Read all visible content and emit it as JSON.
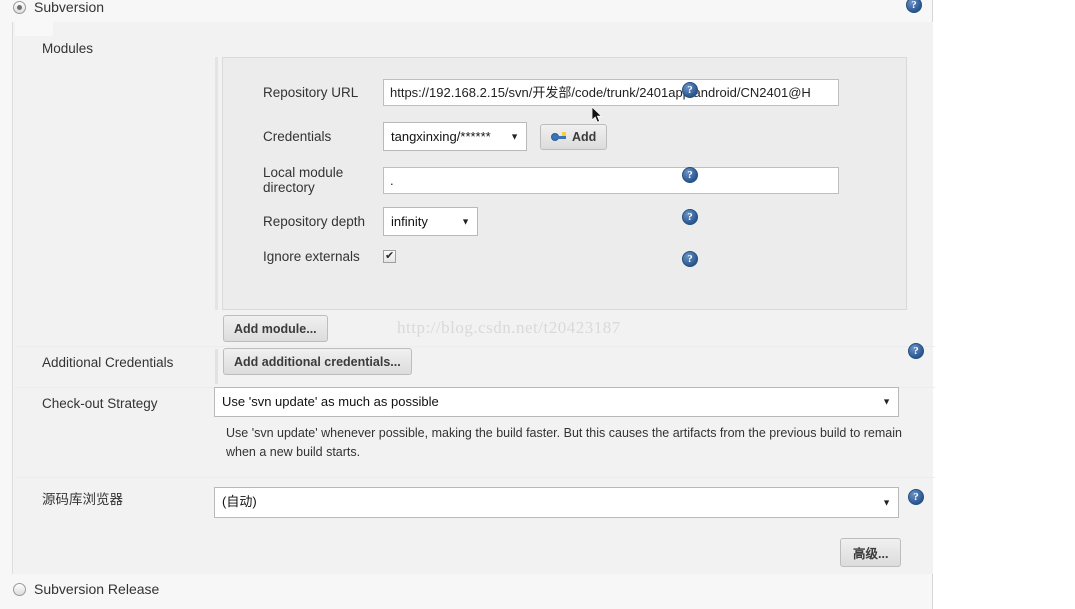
{
  "scm": {
    "selected_option": "Subversion",
    "other_option": "Subversion Release"
  },
  "modules": {
    "section_label": "Modules",
    "repository_url": {
      "label": "Repository URL",
      "value": "https://192.168.2.15/svn/开发部/code/trunk/2401app/android/CN2401@H"
    },
    "credentials": {
      "label": "Credentials",
      "value": "tangxinxing/******",
      "add_button": "Add"
    },
    "local_module_directory": {
      "label": "Local module directory",
      "value": "."
    },
    "repository_depth": {
      "label": "Repository depth",
      "value": "infinity"
    },
    "ignore_externals": {
      "label": "Ignore externals",
      "checked": true
    },
    "add_module_button": "Add module..."
  },
  "additional_credentials": {
    "label": "Additional Credentials",
    "button": "Add additional credentials..."
  },
  "checkout_strategy": {
    "label": "Check-out Strategy",
    "value": "Use 'svn update' as much as possible",
    "description": "Use 'svn update' whenever possible, making the build faster. But this causes the artifacts from the previous build to remain when a new build starts."
  },
  "repository_browser": {
    "label": "源码库浏览器",
    "value": "(自动)"
  },
  "advanced_button": "高级...",
  "help_icon_glyph": "?",
  "watermark": "http://blog.csdn.net/t20423187",
  "colors": {
    "panel_bg": "#f2f2f2",
    "group_bg": "#ececec",
    "help_blue": "#2f5c96",
    "button_face": "#e4e4e4"
  }
}
